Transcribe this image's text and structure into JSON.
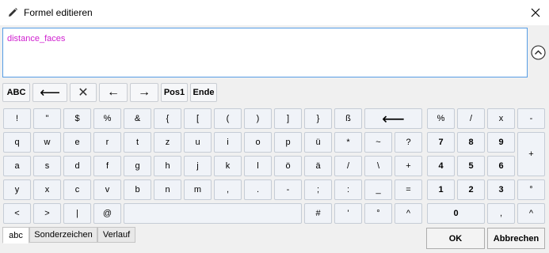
{
  "window": {
    "title": "Formel editieren"
  },
  "editor": {
    "value": "distance_faces"
  },
  "toolbar": [
    "ABC",
    "⟵",
    "✕",
    "←",
    "→",
    "Pos1",
    "Ende"
  ],
  "keys": {
    "row1": [
      "!",
      "\"",
      "$",
      "%",
      "&",
      "{",
      "[",
      "(",
      ")",
      "]",
      "}",
      "ß",
      "⟵"
    ],
    "row2": [
      "q",
      "w",
      "e",
      "r",
      "t",
      "z",
      "u",
      "i",
      "o",
      "p",
      "ü",
      "*",
      "~",
      "?"
    ],
    "row3": [
      "a",
      "s",
      "d",
      "f",
      "g",
      "h",
      "j",
      "k",
      "l",
      "ö",
      "ä",
      "/",
      "\\",
      "+"
    ],
    "row4": [
      "y",
      "x",
      "c",
      "v",
      "b",
      "n",
      "m",
      ",",
      ".",
      "-",
      ";",
      ":",
      "_",
      "="
    ],
    "row5": [
      "<",
      ">",
      "|",
      "@",
      "",
      "#",
      "'",
      "°",
      "^"
    ]
  },
  "numpad": {
    "row1": [
      "%",
      "/",
      "x",
      "-"
    ],
    "row2": [
      "7",
      "8",
      "9"
    ],
    "row3": [
      "4",
      "5",
      "6"
    ],
    "row4": [
      "1",
      "2",
      "3",
      "°"
    ],
    "row5": [
      "0",
      ",",
      "^"
    ],
    "plus": "+"
  },
  "tabs": [
    "abc",
    "Sonderzeichen",
    "Verlauf"
  ],
  "buttons": {
    "ok": "OK",
    "cancel": "Abbrechen"
  }
}
